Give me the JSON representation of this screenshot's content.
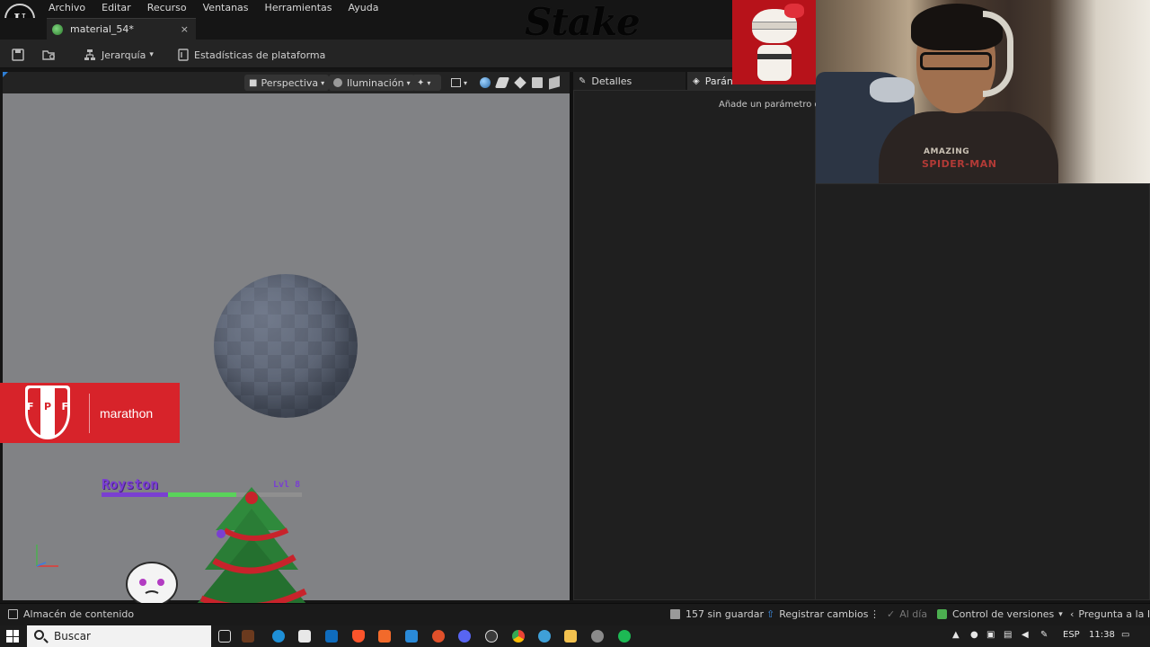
{
  "menu": [
    "Archivo",
    "Editar",
    "Recurso",
    "Ventanas",
    "Herramientas",
    "Ayuda"
  ],
  "doc_tab": {
    "title": "material_54*",
    "close": "×"
  },
  "toolbar": {
    "hierarchy": "Jerarquía",
    "platform_stats": "Estadísticas de plataforma"
  },
  "viewport": {
    "perspective": "Perspectiva",
    "lighting": "Iluminación"
  },
  "panels": {
    "details": "Detalles",
    "params_tab": "Parán",
    "params_hint": "Añade un parámetro de"
  },
  "overlays": {
    "stake": "Stake",
    "banner_letters": [
      "F",
      "P",
      "F"
    ],
    "banner_brand": "marathon",
    "player_name": "Royston",
    "player_level": "Lvl 8",
    "player_hp": 0.33,
    "shirt_line1": "AMAZING",
    "shirt_line2": "SPIDER-MAN"
  },
  "statusbar": {
    "content_browser": "Almacén de contenido",
    "unsaved": "157 sin guardar",
    "submit": "Registrar cambios",
    "up_to_date": "Al día",
    "version_control": "Control de versiones",
    "ask_ai": "Pregunta a la IA"
  },
  "taskbar": {
    "search": "Buscar",
    "lang": "ESP",
    "time": "11:38"
  },
  "colors": {
    "accent": "#2e7fd6",
    "banner_red": "#d7232a",
    "player_purple": "#7a3fd1",
    "hp_green": "#5ad35a",
    "viewport_bg": "#818285"
  }
}
